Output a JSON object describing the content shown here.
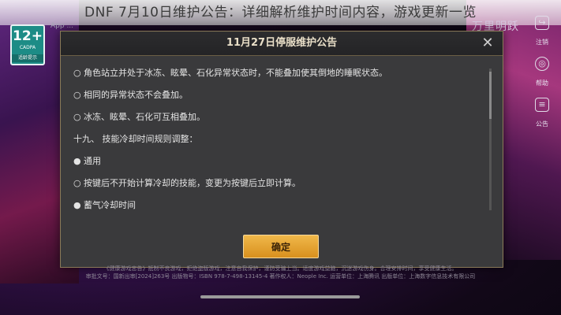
{
  "headline": "DNF 7月10日维护公告：详细解析维护时间内容，游戏更新一览",
  "age_badge": {
    "rating": "12+",
    "org": "CADPA",
    "hint": "适龄提示"
  },
  "top_left_text": "App ...",
  "top_right_logo": "万里明跃",
  "side_menu": [
    {
      "icon": "logout-icon",
      "label": "注销"
    },
    {
      "icon": "help-icon",
      "label": "帮助"
    },
    {
      "icon": "announcement-icon",
      "label": "公告"
    }
  ],
  "modal": {
    "title": "11月27日停服维护公告",
    "close_label": "✕",
    "lines": [
      {
        "marker": "○",
        "text": "角色站立并处于冰冻、眩晕、石化异常状态时，不能叠加使其倒地的睡眠状态。"
      },
      {
        "marker": "○",
        "text": "相同的异常状态不会叠加。"
      },
      {
        "marker": "○",
        "text": "冰冻、眩晕、石化可互相叠加。"
      },
      {
        "marker": "",
        "text": "十九、 技能冷却时间规则调整："
      },
      {
        "marker": "●",
        "text": "通用"
      },
      {
        "marker": "○",
        "text": "按键后不开始计算冷却的技能，变更为按键后立即计算。"
      },
      {
        "marker": "●",
        "text": "蓄气冷却时间"
      }
    ],
    "confirm_label": "确定"
  },
  "footer": {
    "line1": "《健康游戏忠告》抵制不良游戏，拒绝盗版游戏，注意自我保护，谨防受骗上当。适度游戏益脑，沉迷游戏伤身。合理安排时间，享受健康生活。",
    "line2": "审批文号：国新出审[2024]263号  出版物号：ISBN 978-7-498-13145-4  著作权人：Neople Inc.  运营单位：上海腾讯 出版单位：上海数字信息技术有限公司"
  },
  "colors": {
    "accent": "#e6a93a",
    "modal_bg": "#3a3a3c",
    "badge": "#1d8c86"
  }
}
